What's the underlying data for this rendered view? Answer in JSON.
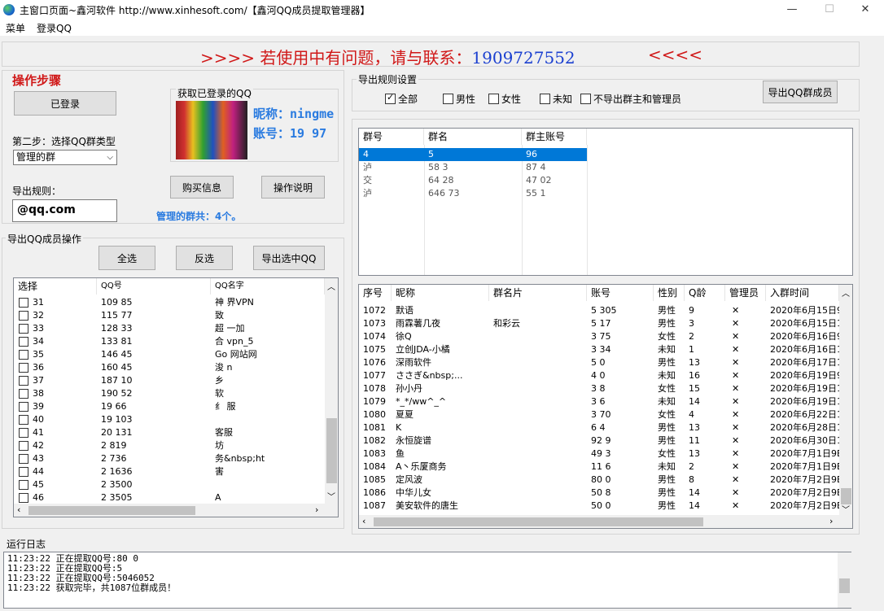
{
  "window": {
    "title": "主窗口页面~鑫河软件 http://www.xinhesoft.com/【鑫河QQ成员提取管理器】",
    "minimize": "—",
    "maximize": "☐",
    "close": "✕"
  },
  "menu": {
    "items": [
      "菜单",
      "登录QQ"
    ]
  },
  "banner": {
    "left_arrows": ">>>> ",
    "text": "若使用中有问题，请与联系：",
    "phone": "1909727552",
    "right_arrows": "<<<<"
  },
  "steps": {
    "heading": "操作步骤",
    "logged_in_button": "已登录",
    "step2_label": "第二步：选择QQ群类型",
    "group_type_selected": "管理的群",
    "export_rule_label": "导出规则：",
    "export_rule_value": "@qq.com",
    "fetched_qq_label": "获取已登录的QQ",
    "nickname_label": "昵称：ningme",
    "account_label": "账号：19  97",
    "buy_button": "购买信息",
    "help_button": "操作说明",
    "group_count": "管理的群共：4个。"
  },
  "member_ops": {
    "label": "导出QQ成员操作",
    "select_all": "全选",
    "invert": "反选",
    "export_selected": "导出选中QQ",
    "columns": [
      "选择",
      "QQ号",
      "QQ名字"
    ],
    "rows": [
      [
        "31",
        "109     85",
        "神     界VPN"
      ],
      [
        "32",
        "115     77",
        "致"
      ],
      [
        "33",
        "128     33",
        "超        一加"
      ],
      [
        "34",
        "133     81",
        "合      vpn_5"
      ],
      [
        "35",
        "146     45",
        "Go       网站网"
      ],
      [
        "36",
        "160     45",
        "浚        n"
      ],
      [
        "37",
        "187     10",
        "乡"
      ],
      [
        "38",
        "190     52",
        "软"
      ],
      [
        "39",
        "19      66",
        "纟      服"
      ],
      [
        "40",
        "19     103",
        ""
      ],
      [
        "41",
        "20     131",
        "      客服"
      ],
      [
        "42",
        "2      819",
        "     坊"
      ],
      [
        "43",
        "2      736",
        "      务&nbsp;ht"
      ],
      [
        "44",
        "2     1636",
        "     害"
      ],
      [
        "45",
        "2     3500",
        ""
      ],
      [
        "46",
        "2     3505",
        "A"
      ]
    ]
  },
  "export_settings": {
    "label": "导出规则设置",
    "options": [
      {
        "label": "全部",
        "checked": true
      },
      {
        "label": "男性",
        "checked": false
      },
      {
        "label": "女性",
        "checked": false
      },
      {
        "label": "未知",
        "checked": false
      },
      {
        "label": "不导出群主和管理员",
        "checked": false
      }
    ],
    "export_button": "导出QQ群成员"
  },
  "groups_table": {
    "columns": [
      "群号",
      "群名",
      "群主账号"
    ],
    "rows": [
      [
        "4        ",
        "5           ",
        "         96"
      ],
      [
        "泸        ",
        "58       3",
        "87     4"
      ],
      [
        "交        ",
        "64     28",
        "47     02"
      ],
      [
        "泸        ",
        "646    73",
        "55       1"
      ]
    ]
  },
  "members_table": {
    "columns": [
      "序号",
      "昵称",
      "群名片",
      "账号",
      "性别",
      "Q龄",
      "管理员",
      "入群时间"
    ],
    "rows": [
      [
        "1072",
        "默语",
        "",
        "5      305",
        "男性",
        "9",
        "✕",
        "2020年6月15日9"
      ],
      [
        "1073",
        "雨霖薯几夜",
        "和彩云",
        "5      17",
        "男性",
        "3",
        "✕",
        "2020年6月15日1"
      ],
      [
        "1074",
        "徐Q",
        "",
        "3     75",
        "女性",
        "2",
        "✕",
        "2020年6月16日9"
      ],
      [
        "1075",
        "立创JDA-小橘",
        "",
        "3     34",
        "未知",
        "1",
        "✕",
        "2020年6月16日1"
      ],
      [
        "1076",
        "深雨软件",
        "",
        "5     0",
        "男性",
        "13",
        "✕",
        "2020年6月17日1"
      ],
      [
        "1077",
        "ささぎ&nbsp;...",
        "",
        "4     0",
        "未知",
        "16",
        "✕",
        "2020年6月19日9"
      ],
      [
        "1078",
        "孙小丹",
        "",
        "3     8",
        "女性",
        "15",
        "✕",
        "2020年6月19日1"
      ],
      [
        "1079",
        "*_*/ww^_^",
        "",
        "3     6",
        "未知",
        "14",
        "✕",
        "2020年6月19日1"
      ],
      [
        "1080",
        "夏夏",
        "",
        "3     70",
        "女性",
        "4",
        "✕",
        "2020年6月22日1"
      ],
      [
        "1081",
        "K",
        "",
        "6     4",
        "男性",
        "13",
        "✕",
        "2020年6月28日1"
      ],
      [
        "1082",
        "永恒旋谱",
        "",
        "92     9",
        "男性",
        "11",
        "✕",
        "2020年6月30日1"
      ],
      [
        "1083",
        "鱼",
        "",
        "49     3",
        "女性",
        "13",
        "✕",
        "2020年7月1日9E"
      ],
      [
        "1084",
        "A丶乐厦商务",
        "",
        "11     6",
        "未知",
        "2",
        "✕",
        "2020年7月1日9E"
      ],
      [
        "1085",
        "定风波",
        "",
        "80     0",
        "男性",
        "8",
        "✕",
        "2020年7月2日9E"
      ],
      [
        "1086",
        "中华儿女",
        "",
        "50     8",
        "男性",
        "14",
        "✕",
        "2020年7月2日9E"
      ],
      [
        "1087",
        "美安软件的唐生",
        "",
        "50     0",
        "男性",
        "14",
        "✕",
        "2020年7月2日9E"
      ]
    ]
  },
  "log": {
    "label": "运行日志",
    "lines": [
      "11:23:22 正在提取QQ号:80     0",
      "11:23:22 正在提取QQ号:5",
      "11:23:22 正在提取QQ号:5046052",
      "11:23:22 获取完毕，共1087位群成员！"
    ]
  }
}
